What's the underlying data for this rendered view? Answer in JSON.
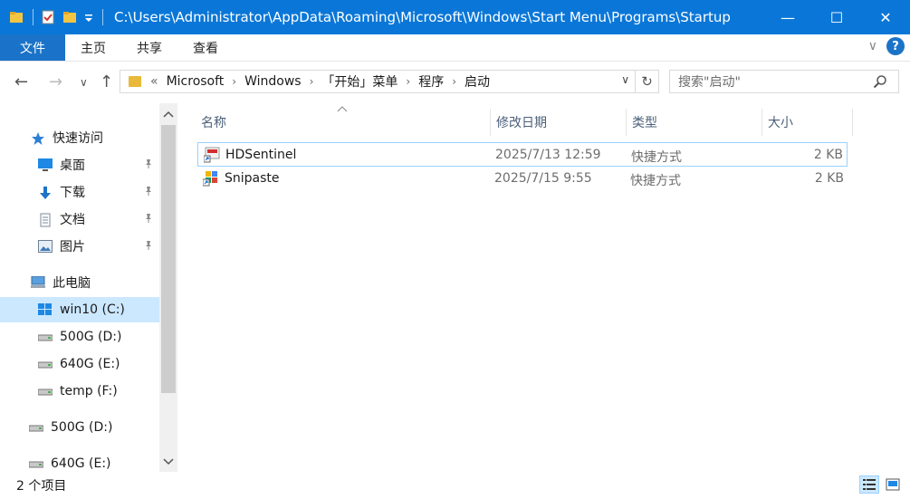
{
  "titlebar": {
    "path": "C:\\Users\\Administrator\\AppData\\Roaming\\Microsoft\\Windows\\Start Menu\\Programs\\Startup",
    "quick_access_icons": [
      "folder-icon",
      "properties-icon",
      "new-folder-icon",
      "customize-dropdown-icon"
    ],
    "buttons": {
      "minimize": "—",
      "maximize": "☐",
      "close": "✕"
    }
  },
  "ribbon": {
    "tabs": [
      {
        "label": "文件",
        "active": true
      },
      {
        "label": "主页"
      },
      {
        "label": "共享"
      },
      {
        "label": "查看"
      }
    ],
    "expand_glyph": "∨",
    "help_glyph": "?"
  },
  "nav": {
    "back": "←",
    "forward": "→",
    "recent": "∨",
    "up": "↑"
  },
  "address": {
    "overflow": "«",
    "crumbs": [
      "Microsoft",
      "Windows",
      "「开始」菜单",
      "程序",
      "启动"
    ],
    "separator": "›",
    "dropdown": "∨",
    "refresh": "↻"
  },
  "search": {
    "placeholder": "搜索\"启动\""
  },
  "navpane": {
    "quick_access": {
      "label": "快速访问",
      "icon": "star-icon"
    },
    "pinned": [
      {
        "label": "桌面",
        "icon": "desktop-icon"
      },
      {
        "label": "下载",
        "icon": "download-icon"
      },
      {
        "label": "文档",
        "icon": "document-icon"
      },
      {
        "label": "图片",
        "icon": "pictures-icon"
      }
    ],
    "this_pc": {
      "label": "此电脑",
      "icon": "computer-icon"
    },
    "drives": [
      {
        "label": "win10 (C:)",
        "icon": "windows-drive-icon",
        "selected": true
      },
      {
        "label": "500G (D:)",
        "icon": "drive-icon"
      },
      {
        "label": "640G (E:)",
        "icon": "drive-icon"
      },
      {
        "label": "temp (F:)",
        "icon": "drive-icon"
      }
    ],
    "extra_drives": [
      {
        "label": "500G (D:)",
        "icon": "drive-icon"
      },
      {
        "label": "640G (E:)",
        "icon": "drive-icon"
      }
    ]
  },
  "columns": {
    "name": "名称",
    "date": "修改日期",
    "type": "类型",
    "size": "大小"
  },
  "files": [
    {
      "name": "HDSentinel",
      "date": "2025/7/13 12:59",
      "type": "快捷方式",
      "size": "2 KB",
      "icon": "hdsentinel-icon"
    },
    {
      "name": "Snipaste",
      "date": "2025/7/15 9:55",
      "type": "快捷方式",
      "size": "2 KB",
      "icon": "snipaste-icon"
    }
  ],
  "status": {
    "count": "2 个项目"
  },
  "colors": {
    "titlebar": "#0a77d8",
    "file_tab": "#1a73c8",
    "selection": "#cce8ff",
    "folder": "#e8b93a"
  }
}
